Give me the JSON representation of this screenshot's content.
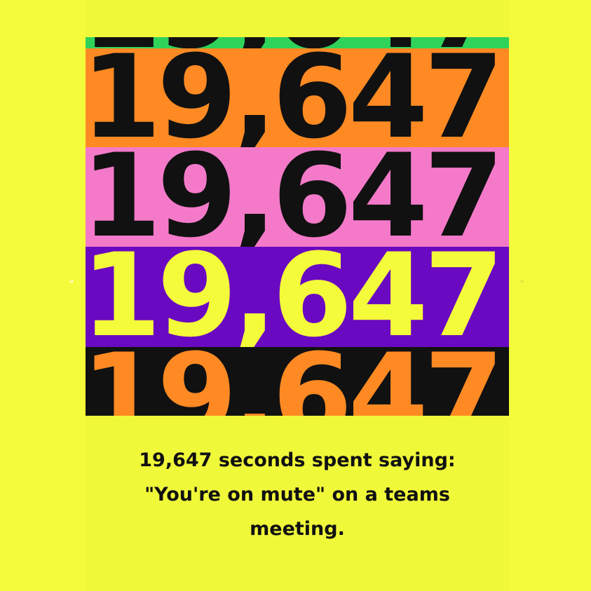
{
  "graphic": {
    "number": "19,647",
    "bands": [
      {
        "name": "green",
        "color": "#2fd35a",
        "text_color": "#111111"
      },
      {
        "name": "orange",
        "color": "#ff8a23",
        "text_color": "#111111"
      },
      {
        "name": "pink",
        "color": "#f47ac9",
        "text_color": "#111111"
      },
      {
        "name": "purple",
        "color": "#6a09c2",
        "text_color": "#f4fb3a"
      },
      {
        "name": "black",
        "color": "#111111",
        "text_color": "#ff8a23"
      }
    ]
  },
  "caption": {
    "lines": [
      "19,647 seconds spent saying:",
      "\"You're on mute\" on a teams",
      "meeting."
    ]
  },
  "colors": {
    "background": "#f4fb3a",
    "text": "#111111"
  }
}
